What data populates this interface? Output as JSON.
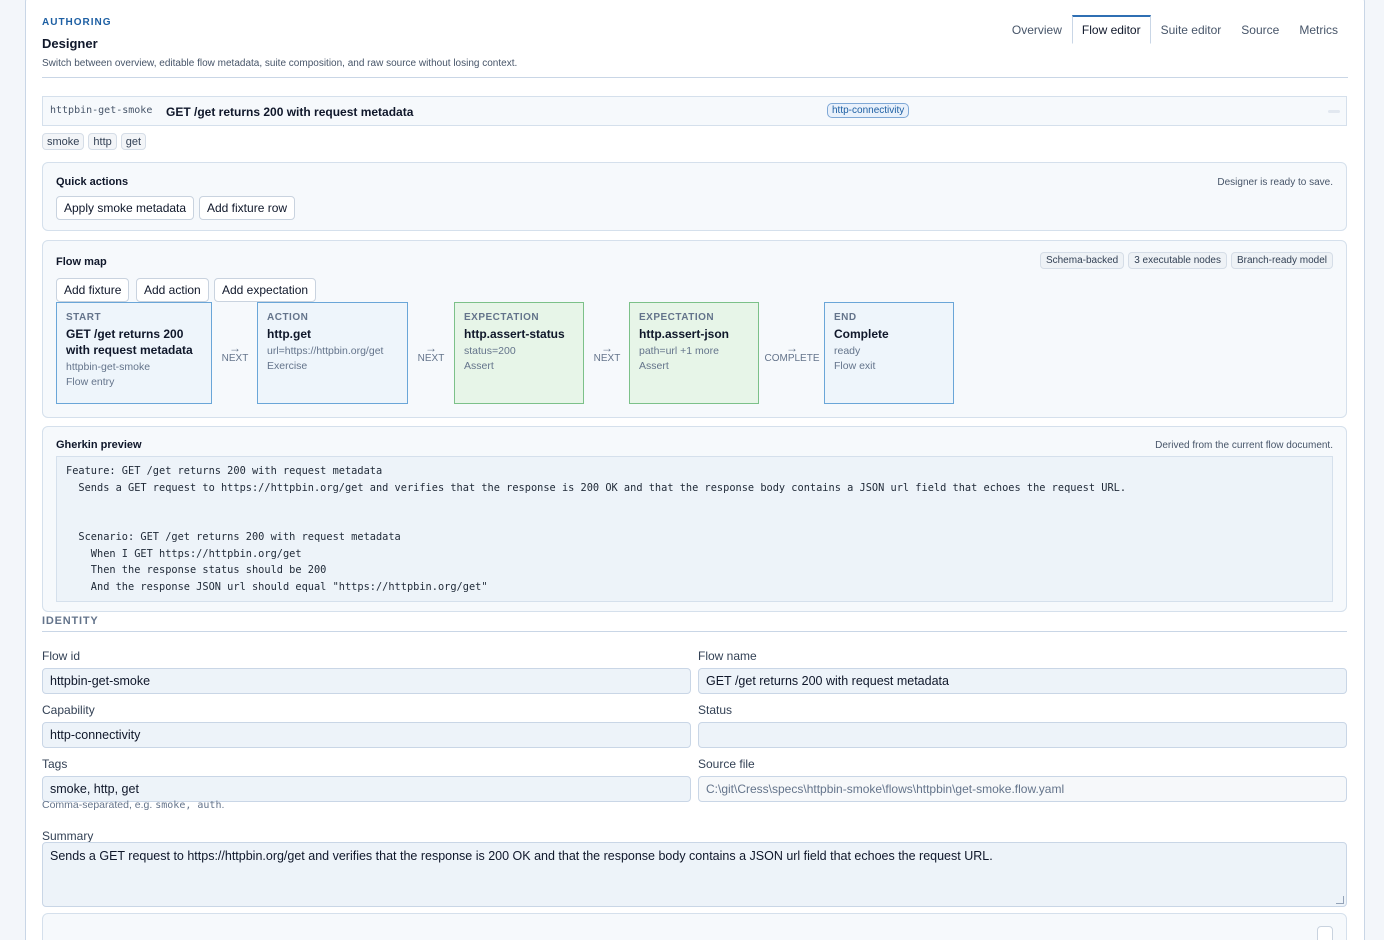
{
  "header": {
    "eyebrow": "AUTHORING",
    "title": "Designer",
    "subtitle": "Switch between overview, editable flow metadata, suite composition, and raw source without losing context."
  },
  "tabs": [
    {
      "label": "Overview",
      "active": false
    },
    {
      "label": "Flow editor",
      "active": true
    },
    {
      "label": "Suite editor",
      "active": false
    },
    {
      "label": "Source",
      "active": false
    },
    {
      "label": "Metrics",
      "active": false
    }
  ],
  "flow": {
    "id": "httpbin-get-smoke",
    "name": "GET /get returns 200 with request metadata",
    "capability": "http-connectivity",
    "tags": [
      "smoke",
      "http",
      "get"
    ]
  },
  "quick_actions": {
    "title": "Quick actions",
    "status": "Designer is ready to save.",
    "buttons": [
      "Apply smoke metadata",
      "Add fixture row"
    ]
  },
  "flow_map": {
    "title": "Flow map",
    "badges": [
      "Schema-backed",
      "3 executable nodes",
      "Branch-ready model"
    ],
    "buttons": [
      "Add fixture",
      "Add action",
      "Add expectation"
    ],
    "nodes": [
      {
        "type": "START",
        "title": "GET /get returns 200 with request metadata",
        "lines": [
          "httpbin-get-smoke",
          "Flow entry"
        ]
      },
      {
        "type": "ACTION",
        "title": "http.get",
        "lines": [
          "url=https://httpbin.org/get",
          "Exercise"
        ]
      },
      {
        "type": "EXPECTATION",
        "title": "http.assert-status",
        "lines": [
          "status=200",
          "Assert"
        ]
      },
      {
        "type": "EXPECTATION",
        "title": "http.assert-json",
        "lines": [
          "path=url +1 more",
          "Assert"
        ]
      },
      {
        "type": "END",
        "title": "Complete",
        "lines": [
          "ready",
          "Flow exit"
        ]
      }
    ],
    "connectors": [
      "NEXT",
      "NEXT",
      "NEXT",
      "COMPLETE"
    ]
  },
  "gherkin": {
    "title": "Gherkin preview",
    "note": "Derived from the current flow document.",
    "text": "Feature: GET /get returns 200 with request metadata\n  Sends a GET request to https://httpbin.org/get and verifies that the response is 200 OK and that the response body contains a JSON url field that echoes the request URL.\n\n\n  Scenario: GET /get returns 200 with request metadata\n    When I GET https://httpbin.org/get\n    Then the response status should be 200\n    And the response JSON url should equal \"https://httpbin.org/get\""
  },
  "identity": {
    "section": "IDENTITY",
    "flow_id_label": "Flow id",
    "flow_id": "httpbin-get-smoke",
    "flow_name_label": "Flow name",
    "flow_name": "GET /get returns 200 with request metadata",
    "capability_label": "Capability",
    "capability": "http-connectivity",
    "status_label": "Status",
    "status": "",
    "tags_label": "Tags",
    "tags": "smoke, http, get",
    "source_label": "Source file",
    "source": "C:\\git\\Cress\\specs\\httpbin-smoke\\flows\\httpbin\\get-smoke.flow.yaml",
    "help_prefix": "Comma-separated, e.g.",
    "help_example": "smoke, auth",
    "help_suffix": ".",
    "summary_label": "Summary",
    "summary": "Sends a GET request to https://httpbin.org/get and verifies that the response is 200 OK and that the response body contains a JSON url field that echoes the request URL."
  }
}
